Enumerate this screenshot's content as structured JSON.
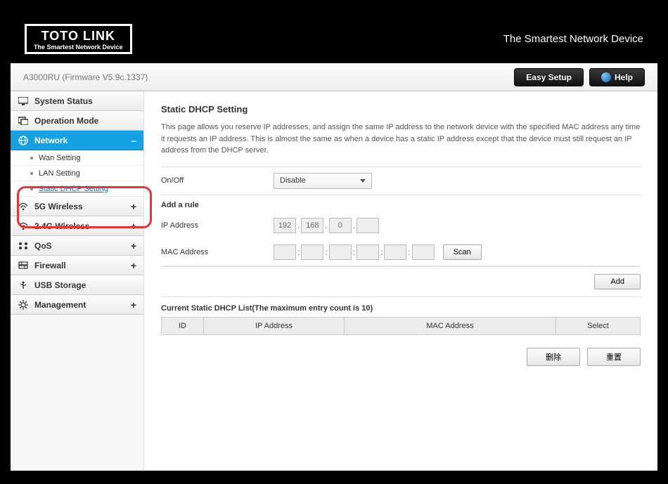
{
  "header": {
    "logo_main": "TOTO LINK",
    "logo_sub": "The Smartest Network Device",
    "tagline": "The Smartest Network Device"
  },
  "subheader": {
    "model": "A3000RU (Firmware V5.9c.1337)",
    "easy_setup": "Easy Setup",
    "help": "Help"
  },
  "sidebar": {
    "items": [
      {
        "label": "System Status",
        "icon": "monitor-icon",
        "expand": ""
      },
      {
        "label": "Operation Mode",
        "icon": "mode-icon",
        "expand": ""
      },
      {
        "label": "Network",
        "icon": "globe-icon",
        "expand": "–",
        "active": true
      },
      {
        "label": "5G Wireless",
        "icon": "wifi-icon",
        "expand": "+"
      },
      {
        "label": "2.4G Wireless",
        "icon": "wifi-icon",
        "expand": "+"
      },
      {
        "label": "QoS",
        "icon": "qos-icon",
        "expand": "+"
      },
      {
        "label": "Firewall",
        "icon": "shield-icon",
        "expand": "+"
      },
      {
        "label": "USB Storage",
        "icon": "usb-icon",
        "expand": ""
      },
      {
        "label": "Management",
        "icon": "gear-icon",
        "expand": "+"
      }
    ],
    "network_sub": [
      {
        "label": "Wan Setting"
      },
      {
        "label": "LAN Setting"
      },
      {
        "label": "Static DHCP Setting",
        "active": true
      }
    ]
  },
  "page": {
    "title": "Static DHCP Setting",
    "desc": "This page allows you reserve IP addresses, and assign the same IP address to the network device with the specified MAC address any time it requests an IP address. This is almost the same as when a device has a static IP address except that the device must still request an IP address from the DHCP server.",
    "onoff_label": "On/Off",
    "onoff_value": "Disable",
    "add_rule_label": "Add a rule",
    "ip_label": "IP Address",
    "ip_parts": [
      "192",
      "168",
      "0",
      ""
    ],
    "mac_label": "MAC Address",
    "mac_parts": [
      "",
      "",
      "",
      "",
      "",
      ""
    ],
    "scan_btn": "Scan",
    "add_btn": "Add",
    "list_title": "Current Static DHCP List(The maximum entry count is 10)",
    "table_headers": [
      "ID",
      "IP Address",
      "MAC Address",
      "Select"
    ],
    "delete_btn": "删除",
    "reset_btn": "重置"
  }
}
